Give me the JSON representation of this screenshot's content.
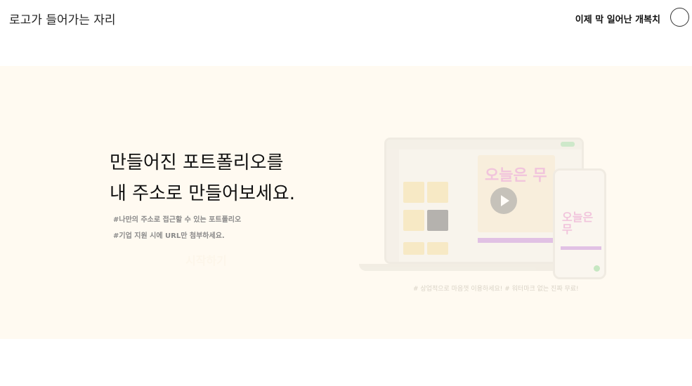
{
  "header": {
    "logo_text": "로고가 들어가는 자리",
    "username": "이제 막 일어난 개복치"
  },
  "hero": {
    "headline_line1": "만들어진 포트폴리오를",
    "headline_line2": "내 주소로 만들어보세요.",
    "tag1": "#나만의 주소로 접근할 수 있는 포트폴리오",
    "tag2": "#기업 지원 시에 URL만 첨부하세요.",
    "start_button": "시작하기",
    "preview_caption": "# 상업적으로 마음껏 이용하세요! # 워터마크 없는 진짜 무료!",
    "preview_title_laptop": "오늘은 무",
    "preview_title_phone": "오늘은 무"
  },
  "colors": {
    "hero_background": "#fffaf1",
    "accent_pink": "#e48fc9",
    "accent_purple": "#c58ad9"
  }
}
